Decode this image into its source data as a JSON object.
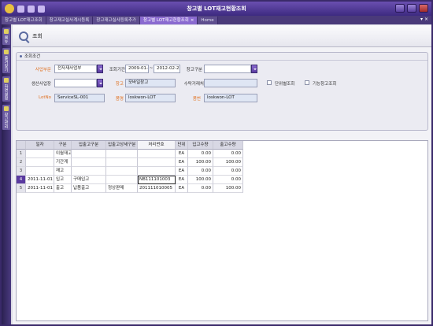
{
  "window": {
    "title": "창고별 LOT재고현황조회"
  },
  "tabs": [
    {
      "label": "창고별 LOT재고조회"
    },
    {
      "label": "창고재고실사계시등록"
    },
    {
      "label": "창고재고실사등록추가"
    },
    {
      "label": "창고별 LOT재고현황조회",
      "active": true
    },
    {
      "label": "Home"
    }
  ],
  "tabbar": {
    "controls": "▾ ×"
  },
  "sidebar": {
    "items": [
      "메뉴",
      "즐겨찾기",
      "화면설정",
      "창고관리"
    ]
  },
  "toolbar": {
    "search_label": "조회"
  },
  "criteria": {
    "header": "조회조건",
    "business_unit": {
      "label": "사업부문",
      "value": "전자재사업부"
    },
    "period": {
      "label": "조회기간",
      "from": "2009-01-01",
      "sep": "~",
      "to": "2012-02-22"
    },
    "warehouse_type": {
      "label": "창고구분",
      "value": ""
    },
    "production_site": {
      "label": "생산사업장",
      "value": ""
    },
    "warehouse": {
      "label": "창고",
      "value": "모바일창고"
    },
    "customer": {
      "label": "수탁거래처",
      "value": ""
    },
    "by_unit": {
      "label": "단위별조회"
    },
    "functional_wh": {
      "label": "기능창고조회"
    },
    "lot_no": {
      "label": "LotNo",
      "value": "ServiceSL-001"
    },
    "item_name": {
      "label": "품명",
      "value": "loskwon-LOT"
    },
    "item_no": {
      "label": "품번",
      "value": "loskwon-LOT"
    }
  },
  "grid": {
    "columns": [
      "",
      "일자",
      "구분",
      "입출고구분",
      "입출고상세구분",
      "처리번호",
      "단위",
      "입고수량",
      "출고수량"
    ],
    "rows": [
      {
        "num": "1",
        "date": "",
        "type": "이월재고",
        "io_type": "",
        "io_detail": "",
        "proc_no": "",
        "unit": "EA",
        "in_qty": "0.00",
        "out_qty": "0.00"
      },
      {
        "num": "2",
        "date": "",
        "type": "기간계",
        "io_type": "",
        "io_detail": "",
        "proc_no": "",
        "unit": "EA",
        "in_qty": "100.00",
        "out_qty": "100.00"
      },
      {
        "num": "3",
        "date": "",
        "type": "재고",
        "io_type": "",
        "io_detail": "",
        "proc_no": "",
        "unit": "EA",
        "in_qty": "0.00",
        "out_qty": "0.00"
      },
      {
        "num": "4",
        "date": "2011-11-01",
        "type": "입고",
        "io_type": "구매입고",
        "io_detail": "",
        "proc_no": "NB111101003",
        "unit": "EA",
        "in_qty": "100.00",
        "out_qty": "0.00"
      },
      {
        "num": "5",
        "date": "2011-11-01",
        "type": "출고",
        "io_type": "납품출고",
        "io_detail": "정상판매",
        "proc_no": "201111010005",
        "unit": "EA",
        "in_qty": "0.00",
        "out_qty": "100.00"
      }
    ]
  }
}
